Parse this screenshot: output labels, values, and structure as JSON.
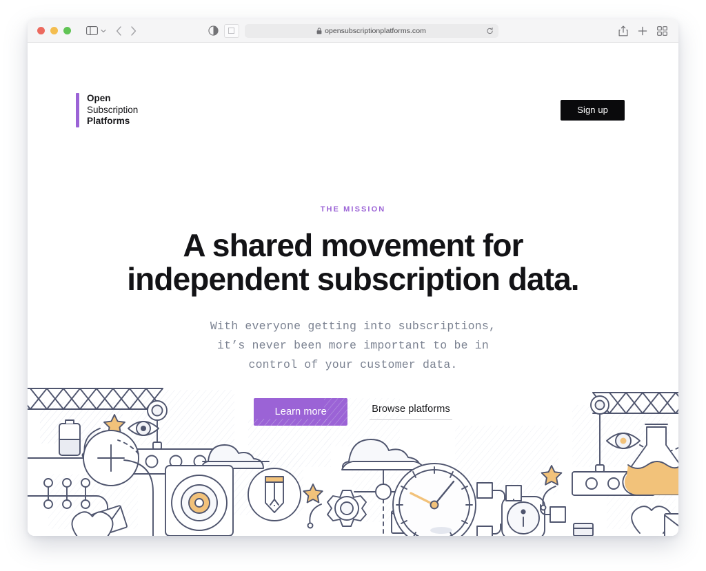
{
  "browser": {
    "traffic_lights": [
      "close",
      "minimize",
      "zoom"
    ],
    "sidebar_icon": "sidebar-icon",
    "sidebar_chevron_icon": "chevron-down-icon",
    "back_icon": "chevron-left-icon",
    "forward_icon": "chevron-right-icon",
    "shield_icon": "privacy-shield-icon",
    "reader_icon": "reader-view-icon",
    "lock_icon": "lock-icon",
    "url": "opensubscriptionplatforms.com",
    "reload_icon": "reload-icon",
    "share_icon": "share-icon",
    "new_tab_icon": "plus-icon",
    "tab_overview_icon": "tab-overview-icon"
  },
  "site": {
    "logo": {
      "line1": "Open",
      "line2": "Subscription",
      "line3": "Platforms",
      "bar_color": "#9b63d6"
    },
    "signup_label": "Sign up"
  },
  "hero": {
    "eyebrow": "THE MISSION",
    "headline_line1": "A shared movement for",
    "headline_line2": "independent subscription data.",
    "subhead_line1": "With everyone getting into subscriptions,",
    "subhead_line2": "it’s never been more important to be in",
    "subhead_line3": "control of your customer data.",
    "primary_cta": "Learn more",
    "secondary_cta": "Browse platforms",
    "accent_color": "#9b63d6",
    "text_color": "#131316",
    "subhead_color": "#7b8291"
  },
  "illustration": {
    "name": "technology-line-art-banner",
    "line_color": "#4f556e",
    "fill_color": "#f2f3f7",
    "accent_color": "#f2c27a",
    "items": [
      "crane-left",
      "battery-icon",
      "star-icon",
      "eye-icon",
      "plus-circle-icon",
      "cloud-icon",
      "container-icon",
      "connector-dots",
      "envelope-icon",
      "heart-icon",
      "pencil-circle-icon",
      "gear-icon",
      "cloud-umbrella-icon",
      "target-circle-icon",
      "clock-icon",
      "info-chip-icon",
      "crane-right",
      "flask-icon",
      "envelope-right-icon"
    ]
  }
}
